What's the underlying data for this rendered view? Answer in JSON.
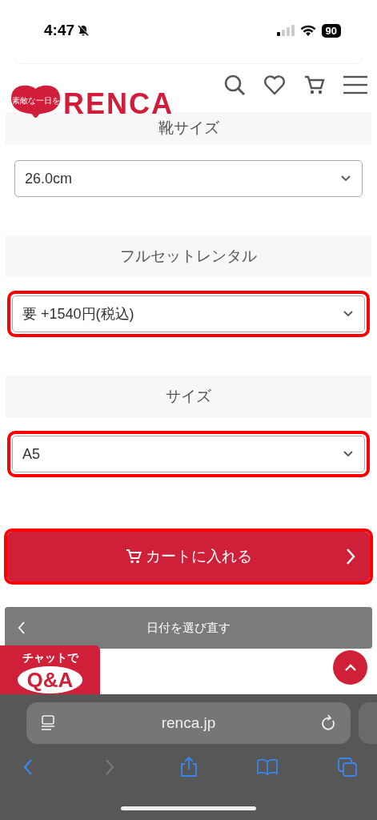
{
  "status_bar": {
    "time": "4:47",
    "silent": true,
    "battery": "90"
  },
  "header": {
    "logo_tagline": "素敵な一日を",
    "logo_text": "RENCA"
  },
  "options": [
    {
      "label": "靴サイズ",
      "value": "26.0cm",
      "highlighted": false
    },
    {
      "label": "フルセットレンタル",
      "value": "要 +1540円(税込)",
      "highlighted": true
    },
    {
      "label": "サイズ",
      "value": "A5",
      "highlighted": true
    }
  ],
  "cart_button": {
    "label": "カートに入れる",
    "highlighted": true
  },
  "reselect_button": {
    "label": "日付を選び直す"
  },
  "chat_badge": {
    "line1": "チャットで",
    "line2": "Q&A"
  },
  "browser": {
    "url": "renca.jp",
    "back_enabled": true,
    "forward_enabled": false
  }
}
